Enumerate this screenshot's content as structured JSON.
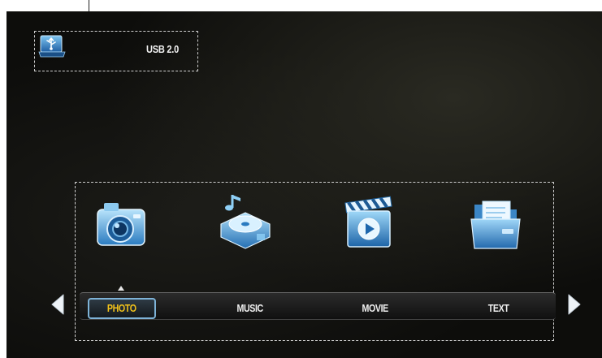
{
  "device": {
    "usb_label": "USB 2.0",
    "usb_icon": "usb-drive-icon"
  },
  "media_icons": [
    {
      "name": "camera-icon"
    },
    {
      "name": "music-disc-icon"
    },
    {
      "name": "clapperboard-icon"
    },
    {
      "name": "folder-icon"
    }
  ],
  "tabs": [
    {
      "label": "PHOTO",
      "selected": true
    },
    {
      "label": "MUSIC",
      "selected": false
    },
    {
      "label": "MOVIE",
      "selected": false
    },
    {
      "label": "TEXT",
      "selected": false
    }
  ],
  "nav": {
    "left_icon": "arrow-left-icon",
    "right_icon": "arrow-right-icon"
  },
  "colors": {
    "selected_text": "#f2c21a",
    "selected_border": "#7eb3d8",
    "background": "#0d0d0b"
  }
}
